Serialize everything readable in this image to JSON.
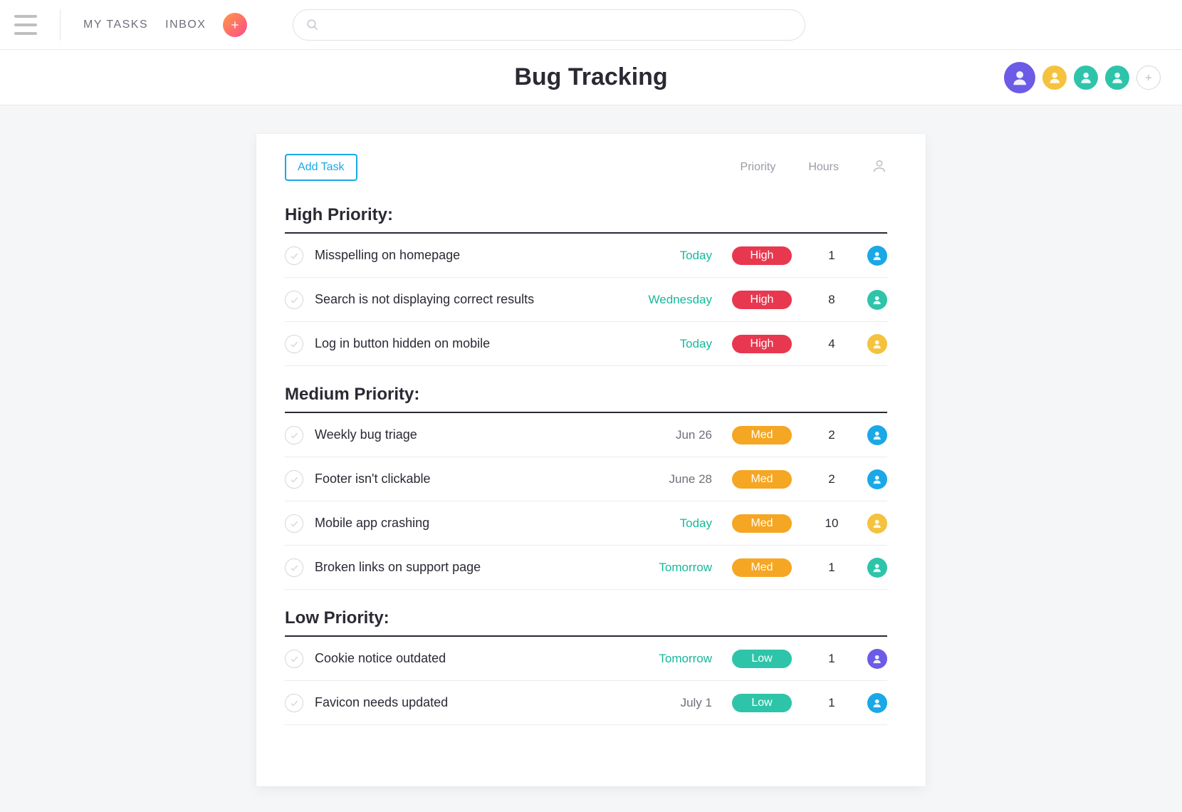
{
  "nav": {
    "my_tasks": "MY TASKS",
    "inbox": "INBOX"
  },
  "search": {
    "placeholder": ""
  },
  "page_title": "Bug Tracking",
  "header_avatars": [
    {
      "color": "#6b5be6"
    },
    {
      "color": "#f5c23e"
    },
    {
      "color": "#2ec4a9"
    },
    {
      "color": "#2ec4a9"
    }
  ],
  "card": {
    "add_task_label": "Add Task",
    "col_priority": "Priority",
    "col_hours": "Hours"
  },
  "sections": [
    {
      "title": "High Priority:",
      "tasks": [
        {
          "title": "Misspelling on homepage",
          "date": "Today",
          "date_soon": true,
          "priority": "High",
          "pill": "pill-high",
          "hours": "1",
          "avatar_color": "#1aa8e6"
        },
        {
          "title": "Search is not displaying correct results",
          "date": "Wednesday",
          "date_soon": true,
          "priority": "High",
          "pill": "pill-high",
          "hours": "8",
          "avatar_color": "#2ec4a9"
        },
        {
          "title": "Log in button hidden on mobile",
          "date": "Today",
          "date_soon": true,
          "priority": "High",
          "pill": "pill-high",
          "hours": "4",
          "avatar_color": "#f5c23e"
        }
      ]
    },
    {
      "title": "Medium Priority:",
      "tasks": [
        {
          "title": "Weekly bug triage",
          "date": "Jun 26",
          "date_soon": false,
          "priority": "Med",
          "pill": "pill-med",
          "hours": "2",
          "avatar_color": "#1aa8e6"
        },
        {
          "title": "Footer isn't clickable",
          "date": "June 28",
          "date_soon": false,
          "priority": "Med",
          "pill": "pill-med",
          "hours": "2",
          "avatar_color": "#1aa8e6"
        },
        {
          "title": "Mobile app crashing",
          "date": "Today",
          "date_soon": true,
          "priority": "Med",
          "pill": "pill-med",
          "hours": "10",
          "avatar_color": "#f5c23e"
        },
        {
          "title": "Broken links on support page",
          "date": "Tomorrow",
          "date_soon": true,
          "priority": "Med",
          "pill": "pill-med",
          "hours": "1",
          "avatar_color": "#2ec4a9"
        }
      ]
    },
    {
      "title": "Low Priority:",
      "tasks": [
        {
          "title": "Cookie notice outdated",
          "date": "Tomorrow",
          "date_soon": true,
          "priority": "Low",
          "pill": "pill-low",
          "hours": "1",
          "avatar_color": "#6b5be6"
        },
        {
          "title": "Favicon needs updated",
          "date": "July 1",
          "date_soon": false,
          "priority": "Low",
          "pill": "pill-low",
          "hours": "1",
          "avatar_color": "#1aa8e6"
        }
      ]
    }
  ]
}
